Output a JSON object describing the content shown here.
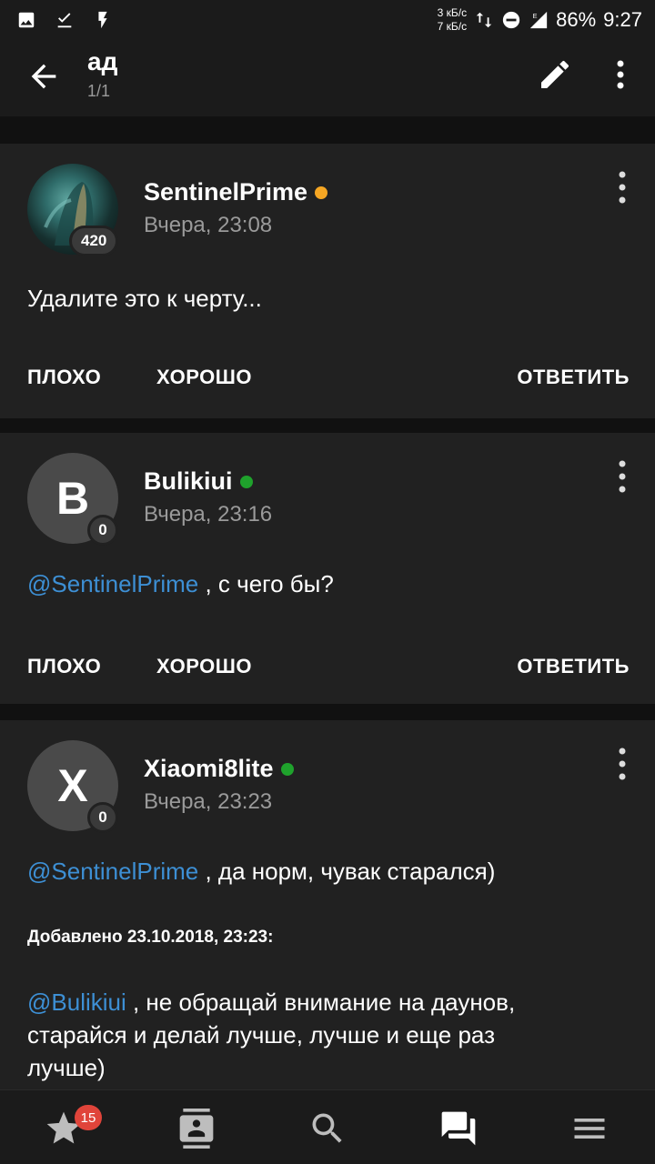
{
  "status_bar": {
    "net_up": "3 кБ/с",
    "net_down": "7 кБ/с",
    "battery": "86%",
    "time": "9:27",
    "icons": [
      "image-icon",
      "check-download-icon",
      "flash-icon",
      "data-transfer-icon",
      "dnd-icon",
      "signal-icon"
    ]
  },
  "header": {
    "title": "ад",
    "subtitle": "1/1",
    "icons": [
      "back-arrow-icon",
      "edit-icon",
      "more-vert-icon"
    ]
  },
  "posts": [
    {
      "author": "SentinelPrime",
      "status_color": "#f5a623",
      "time": "Вчера, 23:08",
      "reputation": "420",
      "body": "Удалите это к черту...",
      "actions": {
        "bad": "ПЛОХО",
        "good": "ХОРОШО",
        "reply": "ОТВЕТИТЬ"
      }
    },
    {
      "author": "Bulikiui",
      "avatar_letter": "B",
      "status_color": "#1fa22c",
      "time": "Вчера, 23:16",
      "reputation": "0",
      "mention": "@SentinelPrime",
      "body": " , с чего бы?",
      "actions": {
        "bad": "ПЛОХО",
        "good": "ХОРОШО",
        "reply": "ОТВЕТИТЬ"
      }
    },
    {
      "author": "Xiaomi8lite",
      "avatar_letter": "X",
      "status_color": "#1fa22c",
      "time": "Вчера, 23:23",
      "reputation": "0",
      "mention": "@SentinelPrime",
      "body": " , да норм, чувак старался)",
      "added_label": "Добавлено 23.10.2018, 23:23:",
      "mention2": "@Bulikiui",
      "body2_line1": " , не обращай внимание на даунов,",
      "body2_line2": "старайся и делай лучше, лучше и еще раз",
      "body2_line3": "лучше)"
    }
  ],
  "bottom_nav": {
    "favorites_badge": "15",
    "icons": [
      "star-icon",
      "contacts-icon",
      "search-icon",
      "forum-icon",
      "menu-icon"
    ]
  },
  "colors": {
    "background": "#111111",
    "card": "#212121",
    "mention": "#3d8fd4",
    "muted": "#9a9a9a"
  }
}
